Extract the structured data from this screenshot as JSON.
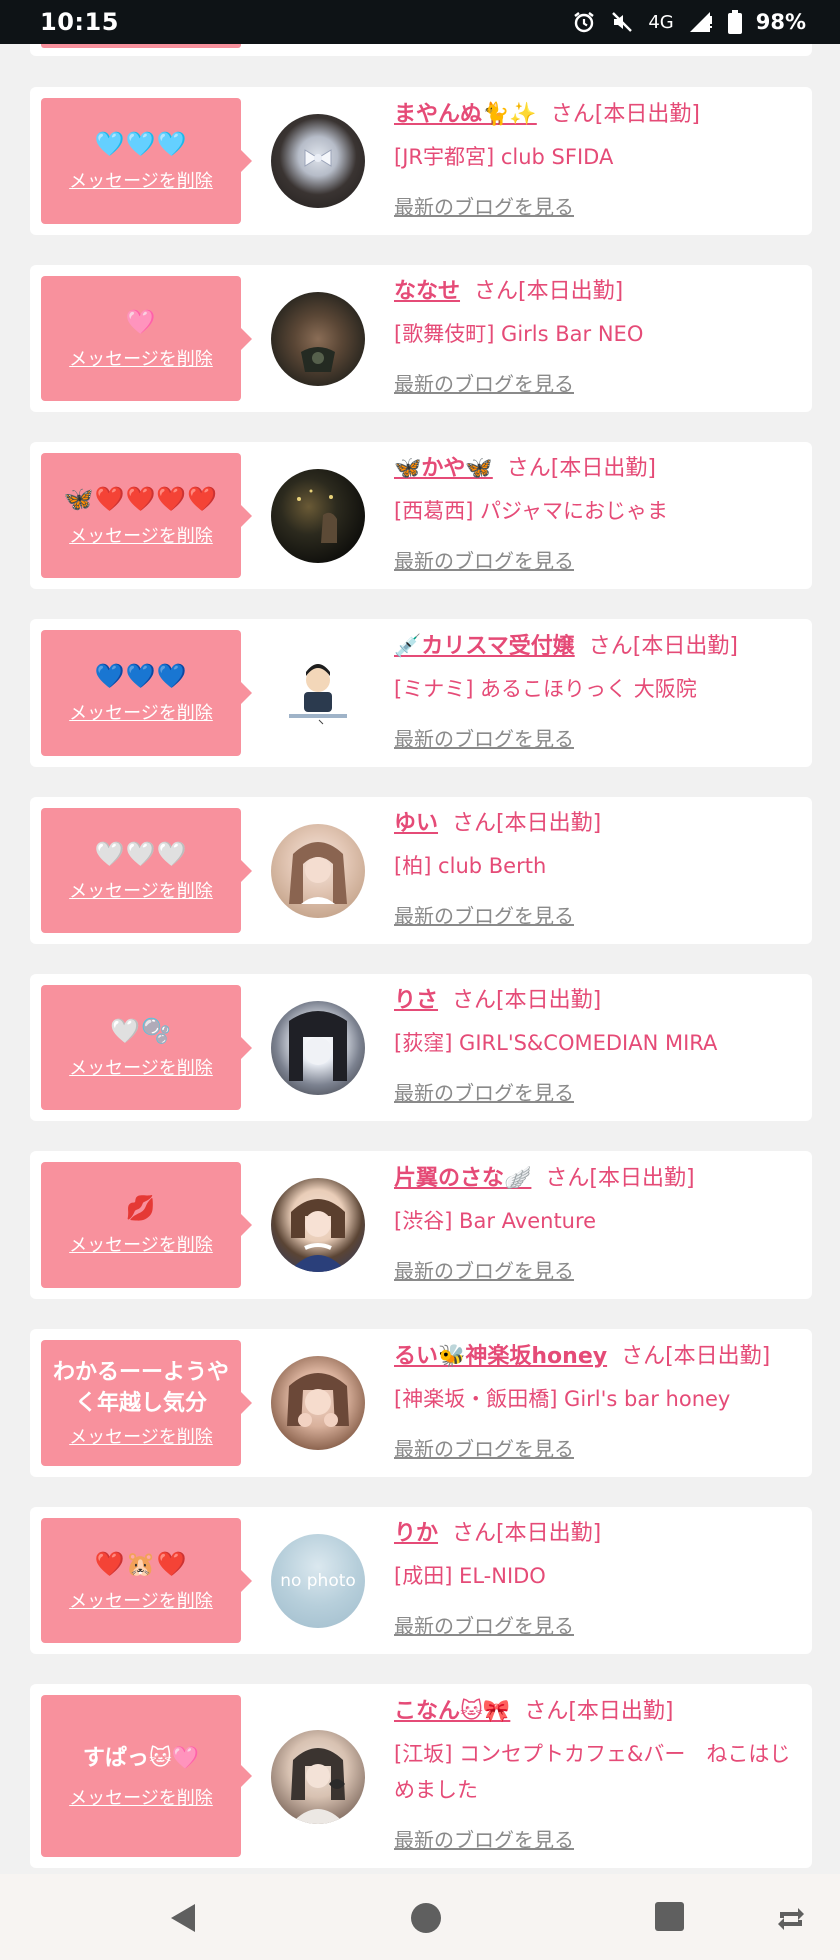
{
  "status_bar": {
    "time": "10:15",
    "network": "4G",
    "battery": "98%"
  },
  "delete_label": "メッセージを削除",
  "blog_label": "最新のブログを見る",
  "san_suffix": "さん[本日出勤]",
  "cards": [
    {
      "message": "🩵🩵🩵",
      "name": "まやんぬ🐈✨",
      "shop": "[JR宇都宮] club SFIDA"
    },
    {
      "message": "🩷",
      "name": "ななせ",
      "shop": "[歌舞伎町] Girls Bar NEO"
    },
    {
      "message": "🦋❤️❤️❤️❤️",
      "name": "🦋かや🦋",
      "shop": "[西葛西] パジャマにおじゃま"
    },
    {
      "message": "💙💙💙",
      "name": "💉カリスマ受付嬢",
      "shop": "[ミナミ] あるこほりっく 大阪院"
    },
    {
      "message": "🤍🤍🤍",
      "name": "ゆい",
      "shop": "[柏] club Berth"
    },
    {
      "message": "🤍🫧",
      "name": "りさ",
      "shop": "[荻窪] GIRL'S&COMEDIAN MIRA"
    },
    {
      "message": "💋",
      "name": "片翼のさな🪽",
      "shop": "[渋谷] Bar Aventure"
    },
    {
      "message": "わかるーーようやく年越し気分",
      "name": "るい🐝神楽坂honey",
      "shop": "[神楽坂・飯田橋] Girl's bar honey"
    },
    {
      "message": "❤️🐹❤️",
      "name": "りか",
      "shop": "[成田] EL-NIDO",
      "avatar_text": "no photo"
    },
    {
      "message": "すぱっ🐱🩷",
      "name": "こなん🐱🎀",
      "shop": "[江坂] コンセプトカフェ&バー　ねこはじめました"
    }
  ],
  "colors": {
    "accent_pink": "#f8919d",
    "name_pink": "#e54b77",
    "link_gray": "#8a8a8a",
    "page_bg": "#f1f1f1"
  }
}
